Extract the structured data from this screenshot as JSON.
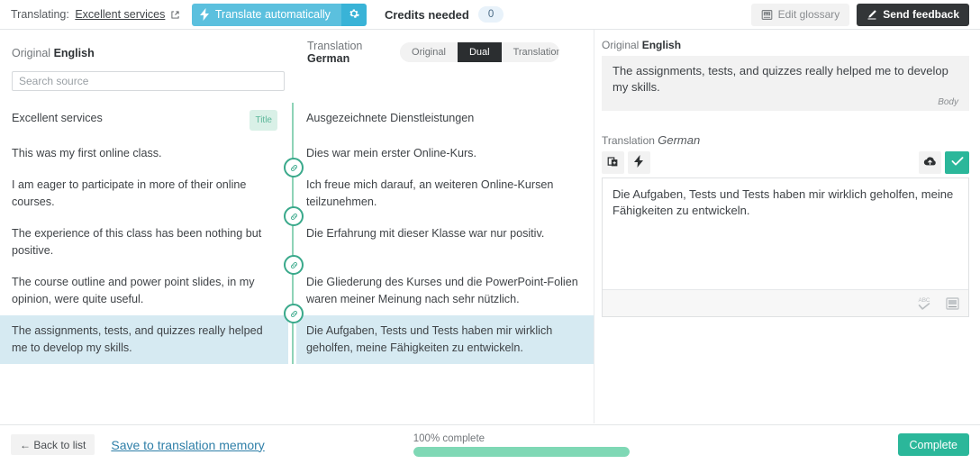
{
  "header": {
    "translating_prefix": "Translating:",
    "document_name": "Excellent services",
    "external_link_icon": "external-link-icon",
    "translate_auto_label": "Translate automatically",
    "translate_auto_icon": "lightning-bolt-icon",
    "translate_settings_icon": "gear-icon",
    "credits_label": "Credits needed",
    "credits_value": "0",
    "edit_glossary_label": "Edit glossary",
    "edit_glossary_icon": "book-az-icon",
    "send_feedback_label": "Send feedback",
    "send_feedback_icon": "pencil-icon",
    "accent_blue": "#5bc0de",
    "accent_blue_dark": "#39b3d7",
    "dark_button": "#333638"
  },
  "left_pane": {
    "source_column_label": "Original",
    "source_language": "English",
    "target_column_label": "Translation",
    "target_language": "German",
    "search_placeholder": "Search source",
    "search_value": "",
    "view_modes": [
      {
        "label": "Original",
        "active": false
      },
      {
        "label": "Dual",
        "active": true
      },
      {
        "label": "Translation",
        "active": false
      }
    ],
    "segments": [
      {
        "source": "Excellent services",
        "target": "Ausgezeichnete Dienstleistungen",
        "tag": "Title",
        "selected": false,
        "link_node": false
      },
      {
        "source": "This was my first online class.",
        "target": "Dies war mein erster Online-Kurs.",
        "tag": "",
        "selected": false,
        "link_node": true
      },
      {
        "source": "I am eager to participate in more of their online courses.",
        "target": "Ich freue mich darauf, an weiteren Online-Kursen teilzunehmen.",
        "tag": "",
        "selected": false,
        "link_node": true
      },
      {
        "source": "The experience of this class has been nothing but positive.",
        "target": "Die Erfahrung mit dieser Klasse war nur positiv.",
        "tag": "",
        "selected": false,
        "link_node": true
      },
      {
        "source": "The course outline and power point slides, in my opinion, were quite useful.",
        "target": "Die Gliederung des Kurses und die PowerPoint-Folien waren meiner Meinung nach sehr nützlich.",
        "tag": "",
        "selected": false,
        "link_node": true
      },
      {
        "source": "The assignments, tests, and quizzes really helped me to develop my skills.",
        "target": "Die Aufgaben, Tests und Tests haben mir wirklich geholfen, meine Fähigkeiten zu entwickeln.",
        "tag": "",
        "selected": true,
        "link_node": false
      }
    ],
    "selected_row_color": "#d6eaf2",
    "link_line_color": "#8ed3b7",
    "title_tag_bg": "#d9f0e7",
    "title_tag_color": "#5cb79a"
  },
  "right_pane": {
    "original_label": "Original",
    "original_language": "English",
    "original_text": "The assignments, tests, and quizzes really helped me to develop my skills.",
    "original_kind": "Body",
    "translation_label": "Translation",
    "translation_language": "German",
    "translation_text": "Die Aufgaben, Tests und Tests haben mir wirklich geholfen, meine Fähigkeiten zu entwickeln.",
    "toolbar": {
      "copy_source_icon": "copy-source-icon",
      "machine_translate_icon": "lightning-bolt-icon",
      "save_cloud_icon": "cloud-upload-icon",
      "confirm_icon": "check-icon",
      "confirm_color": "#2bb79a"
    },
    "footer_tools": {
      "spellcheck_icon": "spellcheck-abc-icon",
      "glossary_icon": "glossary-book-icon"
    }
  },
  "footer": {
    "back_label": "← Back to list",
    "save_tm_label": "Save to translation memory",
    "progress_label": "100% complete",
    "progress_percent": 100,
    "progress_color": "#7fd8b5",
    "complete_label": "Complete",
    "complete_color": "#2bb79a"
  }
}
